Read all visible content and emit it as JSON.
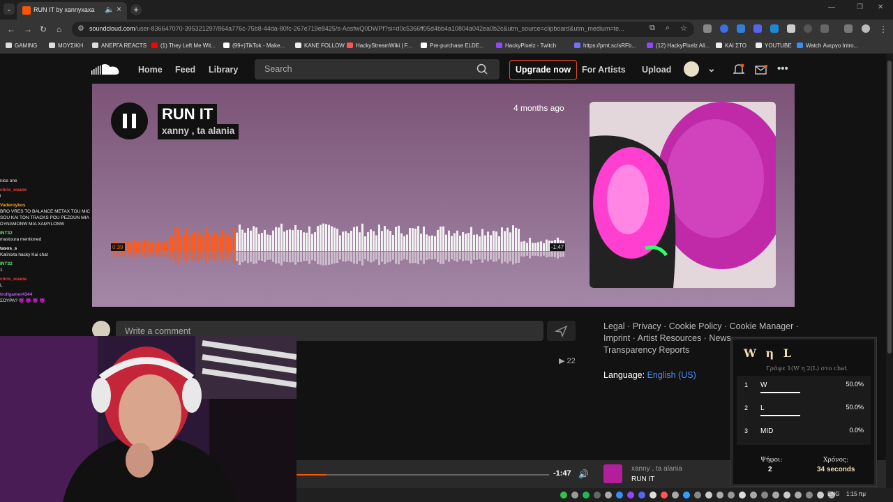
{
  "browser": {
    "tab_title": "RUN IT by xannyxaxa",
    "url_host": "soundcloud.com",
    "url_path": "/user-836647070-395321297/864a776c-75b8-44da-80fc-267e719e8425/s-AosfwQ0DWPf?si=d0c5366ff05d4bb4a10804a042ea0b2c&utm_source=clipboard&utm_medium=te...",
    "bookmarks": [
      "GAMING",
      "ΜΟΥΣΙΚΗ",
      "ΑΝΕΡΓΑ REACTS",
      "(1) They Left Me Wit...",
      "(99+)TikTok - Make...",
      "KANE FOLLOW",
      "HackyStreamWiki | F...",
      "Pre-purchase ELDE...",
      "HackyPixelz - Twitch",
      "https://prnt.sc/sRFb...",
      "(12) HackyPixelz Ali...",
      "ΚΑΙ ΣΤΟ",
      "YOUTUBE",
      "Watch Ανεργο Intro..."
    ]
  },
  "header": {
    "nav": [
      "Home",
      "Feed",
      "Library"
    ],
    "search_placeholder": "Search",
    "upgrade": "Upgrade now",
    "for_artists": "For Artists",
    "upload": "Upload"
  },
  "track": {
    "title": "RUN IT",
    "artist": "xanny , ta alania",
    "posted": "4 months ago",
    "current_time": "0:39",
    "remaining": "-1:47",
    "played_fraction": 0.27,
    "plays": "22"
  },
  "chat": [
    {
      "user": "",
      "msg": "nice one",
      "color": "#ffffff"
    },
    {
      "user": "chris_ouane",
      "msg": "l",
      "color": "#ff3b3b"
    },
    {
      "user": "Vaderoykos",
      "msg": "BRO VRES TO BALANCE METAX TOU MIC SOU KAI TON TRACKS POU PEZOUN MIA DYNAMONW MIA XAMYLONW",
      "color": "#f5a623"
    },
    {
      "user": "INT32",
      "msg": "mastoura mentioned",
      "color": "#5fe37a"
    },
    {
      "user": "tasos_s",
      "msg": "Kalinixta hacky Kai chat",
      "color": "#ffffff"
    },
    {
      "user": "INT32",
      "msg": "1",
      "color": "#5fe37a"
    },
    {
      "user": "chris_ouane",
      "msg": "L",
      "color": "#ff3b3b"
    },
    {
      "user": "trollgamer4344",
      "msg": "ΣΟΥΡΑ? 😈 😈 😈 😈",
      "color": "#b85cff"
    }
  ],
  "comment": {
    "placeholder": "Write a comment"
  },
  "footer": {
    "line1": "Legal · Privacy · Cookie Policy · Cookie Manager ·",
    "line2": "Imprint · Artist Resources · News",
    "line3": "Transparency Reports",
    "language_label": "Language:",
    "language_value": "English (US)"
  },
  "player": {
    "remaining": "-1:47",
    "artist": "xanny , ta alania",
    "title": "RUN IT",
    "progress_fraction": 0.12
  },
  "taskbar": {
    "lang": "ENG",
    "time": "1:15 πμ"
  },
  "poll": {
    "title": "W η L",
    "subtitle": "Γράψε 1(W η 2(L) στο chat.",
    "options": [
      {
        "n": "1",
        "label": "W",
        "pct": "50.0%",
        "frac": 0.5
      },
      {
        "n": "2",
        "label": "L",
        "pct": "50.0%",
        "frac": 0.5
      },
      {
        "n": "3",
        "label": "MID",
        "pct": "0.0%",
        "frac": 0
      }
    ],
    "votes_label": "Ψήφοι:",
    "votes_value": "2",
    "time_label": "Χρόνος:",
    "time_value": "34 seconds"
  }
}
